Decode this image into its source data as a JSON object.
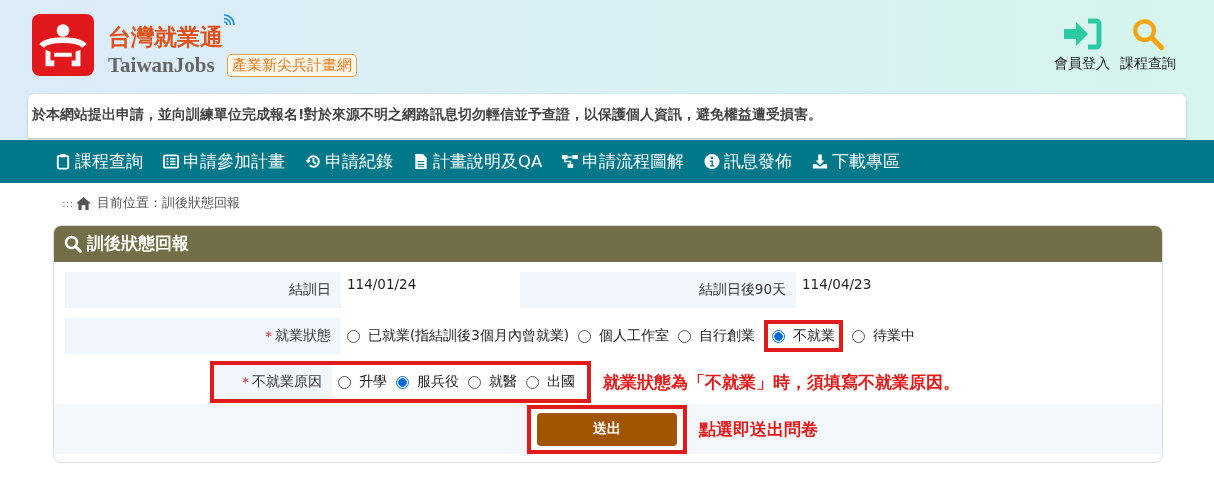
{
  "header": {
    "brand_name": "台灣就業通",
    "brand_latin": "TaiwanJobs",
    "site_tag": "產業新尖兵計畫網"
  },
  "top_links": [
    {
      "label": "會員登入",
      "kind": "login"
    },
    {
      "label": "課程查詢",
      "kind": "search"
    }
  ],
  "notice": "於本網站提出申請，並向訓練單位完成報名!對於來源不明之網路訊息切勿輕信並予查證，以保護個人資訊，避免權益遭受損害。",
  "nav": [
    {
      "label": "課程查詢",
      "kind": "clipboard"
    },
    {
      "label": "申請參加計畫",
      "kind": "list"
    },
    {
      "label": "申請紀錄",
      "kind": "history"
    },
    {
      "label": "計畫說明及QA",
      "kind": "document"
    },
    {
      "label": "申請流程圖解",
      "kind": "flow"
    },
    {
      "label": "訊息發佈",
      "kind": "info"
    },
    {
      "label": "下載專區",
      "kind": "download"
    }
  ],
  "breadcrumb": {
    "marker": ":::",
    "label": "目前位置：訓後狀態回報"
  },
  "panel": {
    "title": "訓後狀態回報",
    "dates": [
      {
        "label": "結訓日",
        "value": "114/01/24"
      },
      {
        "label": "結訓日後90天",
        "value": "114/04/23"
      }
    ],
    "status": {
      "label": "就業狀態",
      "required_mark": "*",
      "options": [
        {
          "label": "已就業(指結訓後3個月內曾就業)",
          "selected": false,
          "highlighted": false
        },
        {
          "label": "個人工作室",
          "selected": false,
          "highlighted": false
        },
        {
          "label": "自行創業",
          "selected": false,
          "highlighted": false
        },
        {
          "label": "不就業",
          "selected": true,
          "highlighted": true
        },
        {
          "label": "待業中",
          "selected": false,
          "highlighted": false
        }
      ]
    },
    "reason": {
      "label": "不就業原因",
      "required_mark": "*",
      "highlighted": true,
      "note": "就業狀態為「不就業」時，須填寫不就業原因。",
      "options": [
        {
          "label": "升學",
          "selected": false
        },
        {
          "label": "服兵役",
          "selected": true
        },
        {
          "label": "就醫",
          "selected": false
        },
        {
          "label": "出國",
          "selected": false
        }
      ]
    },
    "submit": {
      "label": "送出",
      "highlighted": true,
      "note": "點選即送出問卷"
    }
  }
}
